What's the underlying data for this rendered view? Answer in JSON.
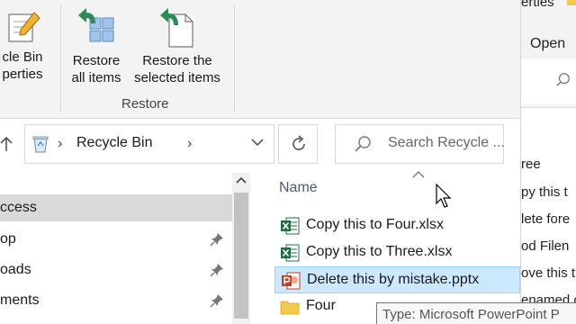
{
  "ribbon": {
    "recycle_props_line1": "cle Bin",
    "recycle_props_line2": "perties",
    "restore_all_line1": "Restore",
    "restore_all_line2": "all items",
    "restore_sel_line1": "Restore the",
    "restore_sel_line2": "selected items",
    "group_label": "Restore"
  },
  "address": {
    "crumb": "Recycle Bin"
  },
  "search": {
    "placeholder": "Search Recycle ..."
  },
  "nav": {
    "items": [
      {
        "label": "ccess",
        "pinned": false,
        "selected": true
      },
      {
        "label": "op",
        "pinned": true,
        "selected": false
      },
      {
        "label": "oads",
        "pinned": true,
        "selected": false
      },
      {
        "label": "ments",
        "pinned": true,
        "selected": false
      }
    ]
  },
  "files": {
    "column_name": "Name",
    "rows": [
      {
        "name": "Copy this to Four.xlsx",
        "icon": "excel-file-icon"
      },
      {
        "name": "Copy this to Three.xlsx",
        "icon": "excel-file-icon"
      },
      {
        "name": "Delete this by mistake.pptx",
        "icon": "powerpoint-file-icon",
        "selected": true
      },
      {
        "name": "Four",
        "icon": "folder-icon"
      }
    ]
  },
  "tooltip": {
    "text": "Type: Microsoft PowerPoint P"
  },
  "background_window": {
    "top_label": "erties",
    "open_label": "Open",
    "lines": [
      "ree",
      "py this t",
      "lete fore",
      "od Filen",
      "ove this t",
      "enamed c"
    ]
  },
  "colors": {
    "ribbon_bg": "#f3f3f3",
    "selection_bg": "#cce8ff",
    "selection_border": "#99d1ff",
    "restore_arrow": "#2e8b57",
    "nav_selected": "#d9d9d9"
  }
}
